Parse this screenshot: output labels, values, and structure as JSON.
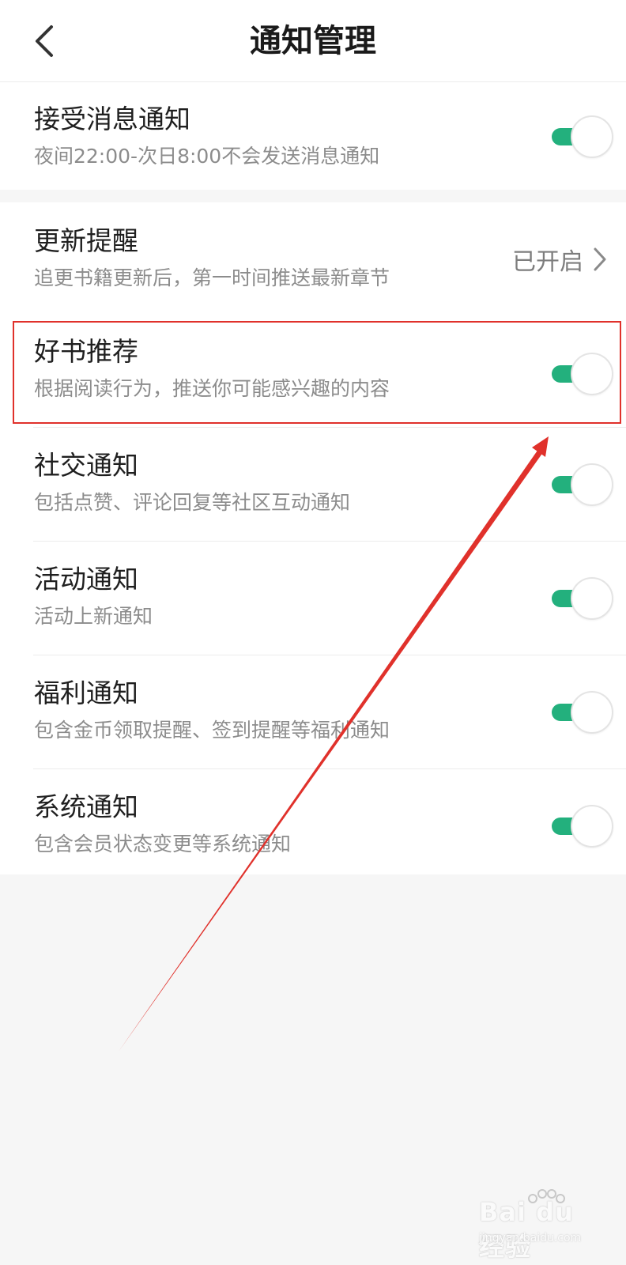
{
  "header": {
    "title": "通知管理",
    "back_icon": "chevron-left-icon"
  },
  "settings": [
    {
      "key": "receive",
      "title": "接受消息通知",
      "subtitle": "夜间22:00-次日8:00不会发送消息通知",
      "control": "toggle",
      "enabled": true
    },
    {
      "key": "update",
      "title": "更新提醒",
      "subtitle": "追更书籍更新后，第一时间推送最新章节",
      "control": "link",
      "status": "已开启"
    },
    {
      "key": "recommend",
      "title": "好书推荐",
      "subtitle": "根据阅读行为，推送你可能感兴趣的内容",
      "control": "toggle",
      "enabled": true
    },
    {
      "key": "social",
      "title": "社交通知",
      "subtitle": "包括点赞、评论回复等社区互动通知",
      "control": "toggle",
      "enabled": true
    },
    {
      "key": "activity",
      "title": "活动通知",
      "subtitle": "活动上新通知",
      "control": "toggle",
      "enabled": true
    },
    {
      "key": "welfare",
      "title": "福利通知",
      "subtitle": "包含金币领取提醒、签到提醒等福利通知",
      "control": "toggle",
      "enabled": true
    },
    {
      "key": "system",
      "title": "系统通知",
      "subtitle": "包含会员状态变更等系统通知",
      "control": "toggle",
      "enabled": true
    }
  ],
  "colors": {
    "toggle_on": "#23b07d",
    "annotation": "#e0312b"
  },
  "watermark": {
    "text": "Bai du 经验",
    "url": "jingyan.baidu.com"
  }
}
